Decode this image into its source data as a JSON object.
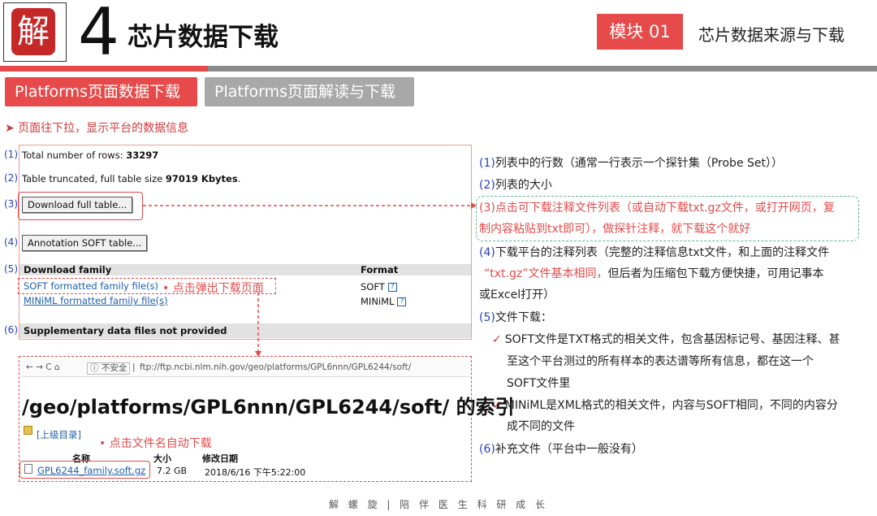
{
  "header": {
    "logo_char": "解",
    "number": "4",
    "title": "芯片数据下载",
    "module_badge": "模块 01",
    "module_title": "芯片数据来源与下载"
  },
  "tabs": [
    {
      "label": "Platforms页面数据下载",
      "active": true
    },
    {
      "label": "Platforms页面解读与下载",
      "active": false
    }
  ],
  "intro": "➤ 页面往下拉，显示平台的数据信息",
  "geo": {
    "row1_num": "(1)",
    "row1_text": "Total number of rows: ",
    "row1_value": "33297",
    "row2_num": "(2)",
    "row2_text": "Table truncated, full table size ",
    "row2_value": "97019 Kbytes",
    "row2_suffix": ".",
    "row3_num": "(3)",
    "download_btn": "Download full table...",
    "row4_num": "(4)",
    "annotation_btn": "Annotation SOFT table...",
    "row5_num": "(5)",
    "family_header": "Download family",
    "format_header": "Format",
    "soft_link": "SOFT formatted family file(s)",
    "soft_format": "SOFT",
    "miniml_link": "MINiML formatted family file(s)",
    "miniml_format": "MINiML",
    "help_icon": "?",
    "note_popup": "• 点击弹出下载页面",
    "row6_num": "(6)",
    "supplementary": "Supplementary data files not provided"
  },
  "ftp": {
    "nav_icons": "← → C ⌂",
    "security": "ⓘ 不安全",
    "separator": "|",
    "url": "ftp://ftp.ncbi.nlm.nih.gov/geo/platforms/GPL6nnn/GPL6244/soft/",
    "heading": "/geo/platforms/GPL6nnn/GPL6244/soft/ 的索引",
    "parent_dir": "[上级目录]",
    "note_auto": "•  点击文件名自动下载",
    "col_name": "名称",
    "col_size": "大小",
    "col_date": "修改日期",
    "file_name": "GPL6244_family.soft.gz",
    "file_size": "7.2 GB",
    "file_date": "2018/6/16 下午5:22:00"
  },
  "explain": {
    "l1_num": "(1)",
    "l1": "列表中的行数（通常一行表示一个探针集（Probe Set））",
    "l2_num": "(2)",
    "l2": "列表的大小",
    "l3_num": "(3)",
    "l3a": "点击可下载注释文件列表（或自动下载txt.gz文件，或打开网页，复",
    "l3b": "制内容粘贴到txt即可）",
    "l3c": "，做探针注释，就下载这个就好",
    "l4_num": "(4)",
    "l4a": "下载平台的注释列表（完整的注释信息txt文件，和上面的注释文件",
    "l4b_red": "“txt.gz”文件基本相同，",
    "l4b": "但后者为压缩包下载方便快捷，可用记事本",
    "l4c": "或Excel打开）",
    "l5_num": "(5)",
    "l5": "文件下载：",
    "check": "✓",
    "b1a": "SOFT文件是TXT格式的相关文件，包含基因标记号、基因注释、甚",
    "b1b": "至这个平台测过的所有样本的表达谱等所有信息，都在这一个",
    "b1c": "SOFT文件里",
    "b2a": "MINiML是XML格式的相关文件，内容与SOFT相同，不同的内容分",
    "b2b": "成不同的文件",
    "l6_num": "(6)",
    "l6": "补充文件（平台中一般没有）"
  },
  "footer": "解 螺 旋   |   陪 伴 医 生 科 研 成 长",
  "colors": {
    "accent": "#e64a4a",
    "gray": "#8a8a8a",
    "num_blue": "#2a3fbf",
    "link": "#1c5fb0",
    "green": "#64b58d"
  }
}
